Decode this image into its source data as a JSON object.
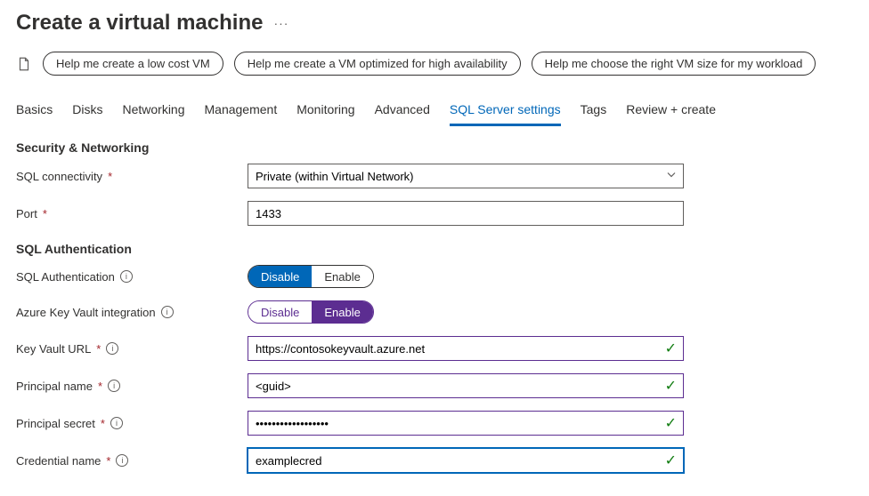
{
  "header": {
    "title": "Create a virtual machine"
  },
  "suggestions": {
    "items": [
      "Help me create a low cost VM",
      "Help me create a VM optimized for high availability",
      "Help me choose the right VM size for my workload"
    ]
  },
  "tabs": {
    "items": [
      "Basics",
      "Disks",
      "Networking",
      "Management",
      "Monitoring",
      "Advanced",
      "SQL Server settings",
      "Tags",
      "Review + create"
    ],
    "active_index": 6
  },
  "sections": {
    "security_networking": "Security & Networking",
    "sql_auth": "SQL Authentication"
  },
  "fields": {
    "sql_connectivity": {
      "label": "SQL connectivity",
      "value": "Private (within Virtual Network)"
    },
    "port": {
      "label": "Port",
      "value": "1433"
    },
    "sql_authentication": {
      "label": "SQL Authentication",
      "options": {
        "disable": "Disable",
        "enable": "Enable"
      },
      "selected": "disable"
    },
    "akv_integration": {
      "label": "Azure Key Vault integration",
      "options": {
        "disable": "Disable",
        "enable": "Enable"
      },
      "selected": "enable"
    },
    "key_vault_url": {
      "label": "Key Vault URL",
      "value": "https://contosokeyvault.azure.net"
    },
    "principal_name": {
      "label": "Principal name",
      "value": "<guid>"
    },
    "principal_secret": {
      "label": "Principal secret",
      "value": "••••••••••••••••••"
    },
    "credential_name": {
      "label": "Credential name",
      "value": "examplecred"
    }
  }
}
